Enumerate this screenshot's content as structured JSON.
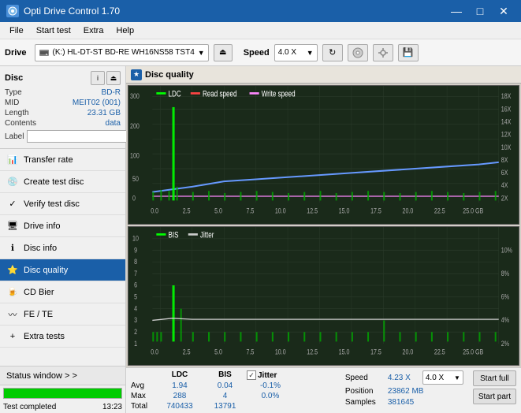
{
  "titlebar": {
    "title": "Opti Drive Control 1.70",
    "icon": "O",
    "btn_minimize": "—",
    "btn_maximize": "□",
    "btn_close": "✕"
  },
  "menubar": {
    "items": [
      "File",
      "Start test",
      "Extra",
      "Help"
    ]
  },
  "toolbar": {
    "drive_label": "Drive",
    "drive_value": "(K:) HL-DT-ST BD-RE WH16NS58 TST4",
    "speed_label": "Speed",
    "speed_value": "4.0 X"
  },
  "disc": {
    "title": "Disc",
    "type_label": "Type",
    "type_value": "BD-R",
    "mid_label": "MID",
    "mid_value": "MEIT02 (001)",
    "length_label": "Length",
    "length_value": "23.31 GB",
    "contents_label": "Contents",
    "contents_value": "data",
    "label_label": "Label",
    "label_value": ""
  },
  "nav": {
    "items": [
      {
        "id": "transfer-rate",
        "label": "Transfer rate",
        "active": false
      },
      {
        "id": "create-test-disc",
        "label": "Create test disc",
        "active": false
      },
      {
        "id": "verify-test-disc",
        "label": "Verify test disc",
        "active": false
      },
      {
        "id": "drive-info",
        "label": "Drive info",
        "active": false
      },
      {
        "id": "disc-info",
        "label": "Disc info",
        "active": false
      },
      {
        "id": "disc-quality",
        "label": "Disc quality",
        "active": true
      },
      {
        "id": "cd-bier",
        "label": "CD Bier",
        "active": false
      },
      {
        "id": "fe-te",
        "label": "FE / TE",
        "active": false
      },
      {
        "id": "extra-tests",
        "label": "Extra tests",
        "active": false
      }
    ]
  },
  "status": {
    "window_label": "Status window > >",
    "progress": 100,
    "status_text": "Test completed",
    "time": "13:23"
  },
  "content": {
    "title": "Disc quality",
    "chart1": {
      "legend": [
        {
          "label": "LDC",
          "color": "#00ff00"
        },
        {
          "label": "Read speed",
          "color": "#ff0000"
        },
        {
          "label": "Write speed",
          "color": "#ff88ff"
        }
      ],
      "y_left": [
        "300",
        "200",
        "100",
        "50",
        "0"
      ],
      "y_right": [
        "18X",
        "16X",
        "14X",
        "12X",
        "10X",
        "8X",
        "6X",
        "4X",
        "2X"
      ],
      "x_labels": [
        "0.0",
        "2.5",
        "5.0",
        "7.5",
        "10.0",
        "12.5",
        "15.0",
        "17.5",
        "20.0",
        "22.5",
        "25.0 GB"
      ]
    },
    "chart2": {
      "legend": [
        {
          "label": "BIS",
          "color": "#00ff00"
        },
        {
          "label": "Jitter",
          "color": "#ffffff"
        }
      ],
      "y_left": [
        "10",
        "9",
        "8",
        "7",
        "6",
        "5",
        "4",
        "3",
        "2",
        "1"
      ],
      "y_right": [
        "10%",
        "8%",
        "6%",
        "4%",
        "2%"
      ],
      "x_labels": [
        "0.0",
        "2.5",
        "5.0",
        "7.5",
        "10.0",
        "12.5",
        "15.0",
        "17.5",
        "20.0",
        "22.5",
        "25.0 GB"
      ]
    }
  },
  "stats": {
    "ldc_header": "LDC",
    "bis_header": "BIS",
    "jitter_header": "Jitter",
    "avg_label": "Avg",
    "max_label": "Max",
    "total_label": "Total",
    "ldc_avg": "1.94",
    "ldc_max": "288",
    "ldc_total": "740433",
    "bis_avg": "0.04",
    "bis_max": "4",
    "bis_total": "13791",
    "jitter_avg": "-0.1%",
    "jitter_max": "0.0%",
    "jitter_total": "",
    "jitter_checked": true,
    "speed_label": "Speed",
    "speed_value": "4.23 X",
    "speed_dropdown": "4.0 X",
    "position_label": "Position",
    "position_value": "23862 MB",
    "samples_label": "Samples",
    "samples_value": "381645",
    "btn_start_full": "Start full",
    "btn_start_part": "Start part"
  }
}
